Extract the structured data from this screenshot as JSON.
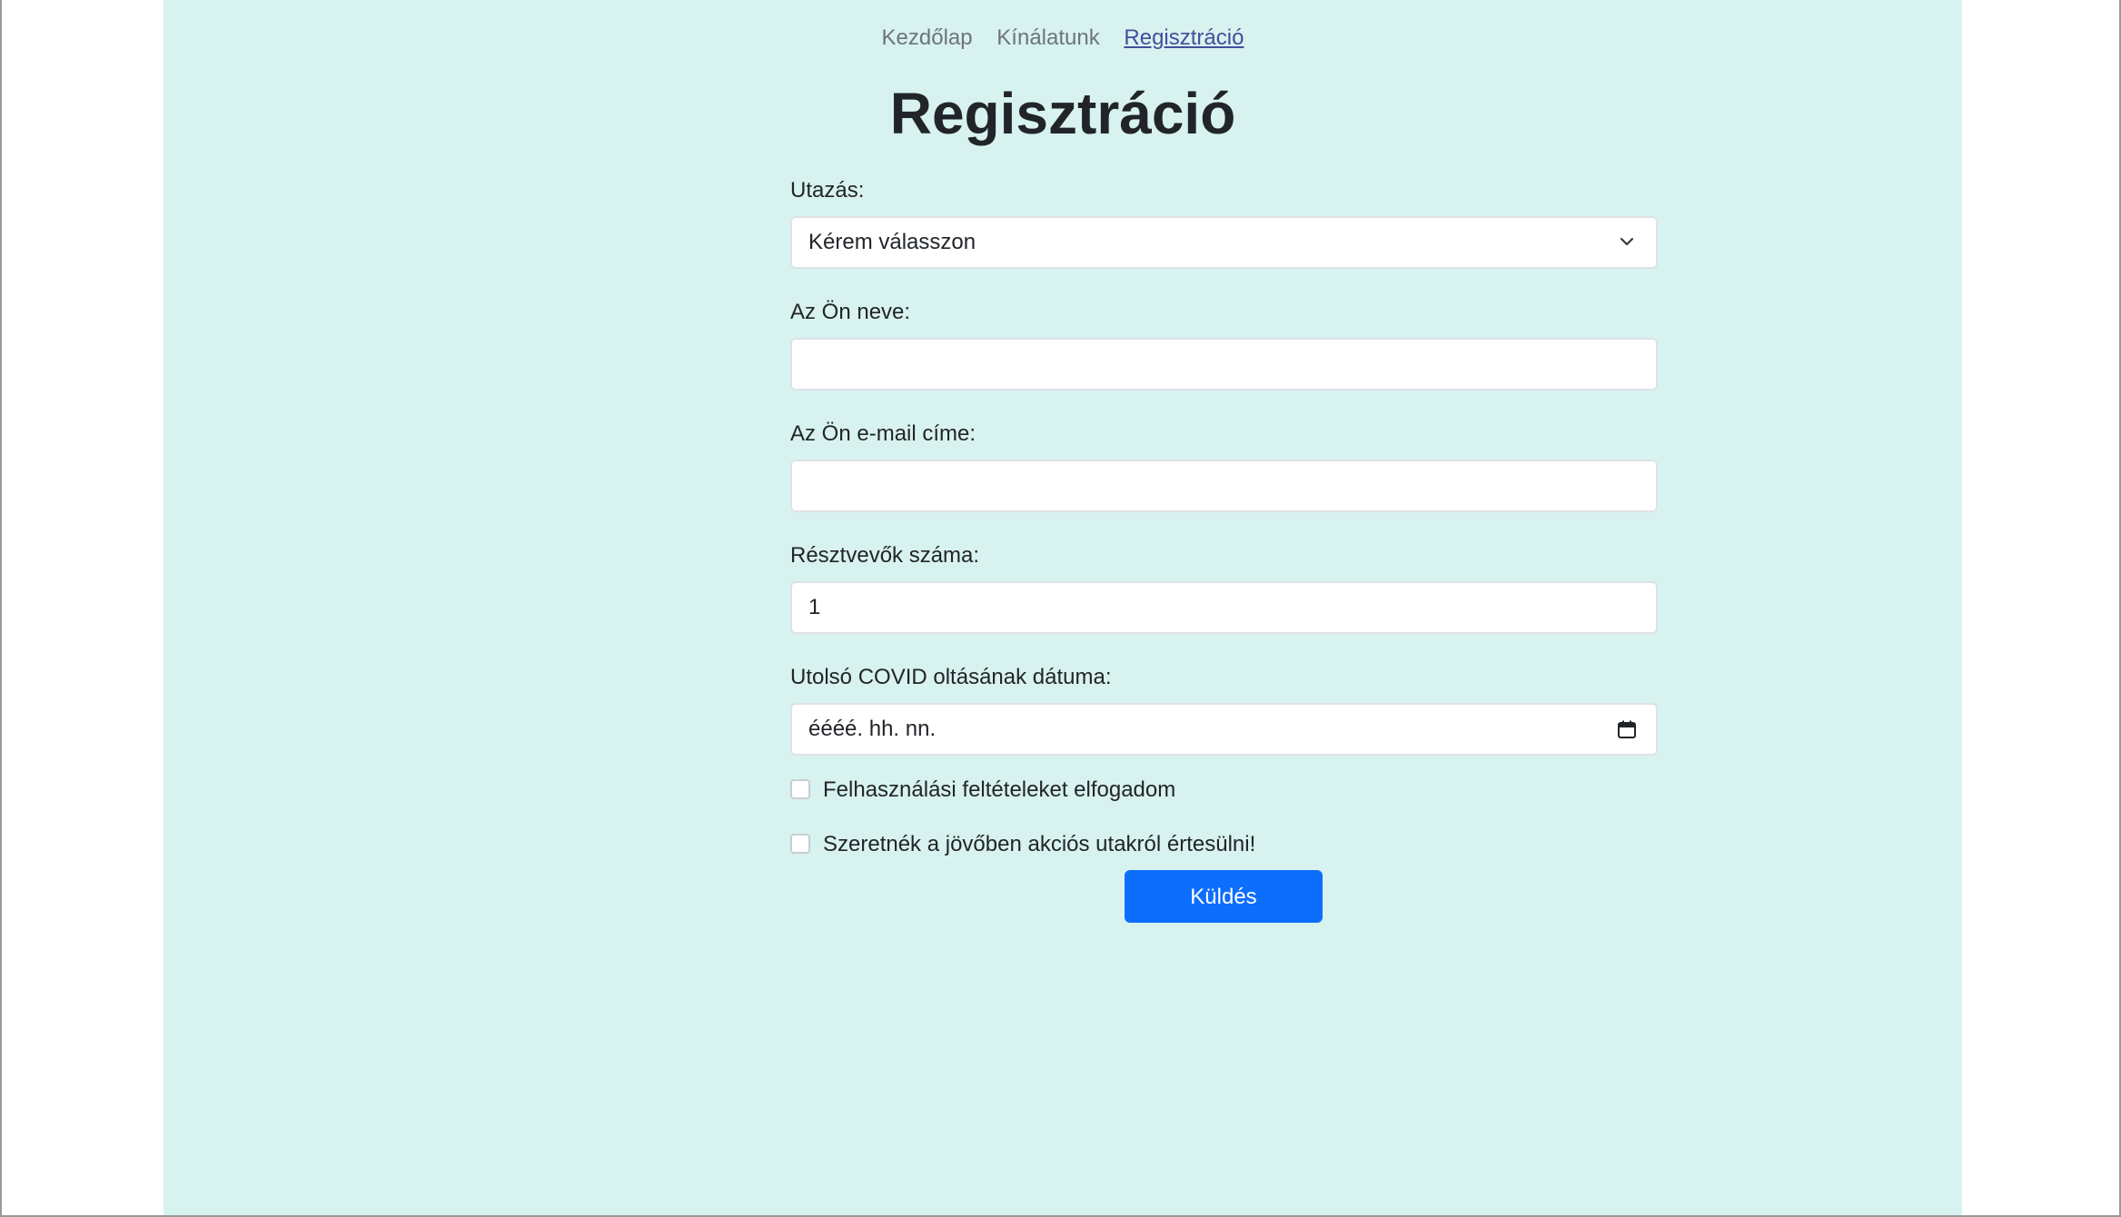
{
  "nav": {
    "items": [
      {
        "label": "Kezdőlap"
      },
      {
        "label": "Kínálatunk"
      },
      {
        "label": "Regisztráció"
      }
    ]
  },
  "page_title": "Regisztráció",
  "form": {
    "trip": {
      "label": "Utazás:",
      "selected": "Kérem válasszon"
    },
    "name": {
      "label": "Az Ön neve:",
      "value": ""
    },
    "email": {
      "label": "Az Ön e-mail címe:",
      "value": ""
    },
    "participants": {
      "label": "Résztvevők száma:",
      "value": "1"
    },
    "covid_date": {
      "label": "Utolsó COVID oltásának dátuma:",
      "placeholder": "éééé. hh. nn."
    },
    "terms": {
      "label": "Felhasználási feltételeket elfogadom",
      "checked": false
    },
    "newsletter": {
      "label": "Szeretnék a jövőben akciós utakról értesülni!",
      "checked": false
    },
    "submit_label": "Küldés"
  },
  "icons": {
    "select": "chevron-down-icon",
    "date": "calendar-icon"
  },
  "colors": {
    "page_background": "#d8f2ef",
    "primary": "#0d6efd",
    "nav_active": "#434f9b"
  }
}
